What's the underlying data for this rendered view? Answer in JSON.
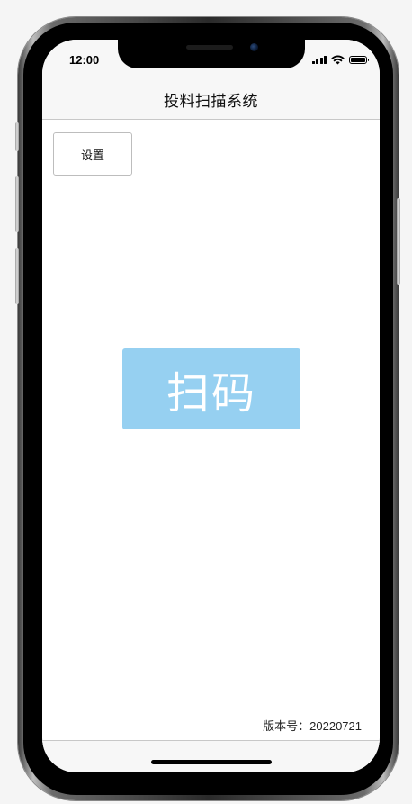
{
  "status_bar": {
    "time": "12:00"
  },
  "nav": {
    "title": "投料扫描系统"
  },
  "settings_button": {
    "label": "设置"
  },
  "scan_button": {
    "label": "扫码",
    "color": "#96d0f1"
  },
  "footer": {
    "version_text": "版本号：20220721"
  },
  "icons": {
    "signal": "cellular-signal-icon",
    "wifi": "wifi-icon",
    "battery": "battery-icon"
  }
}
